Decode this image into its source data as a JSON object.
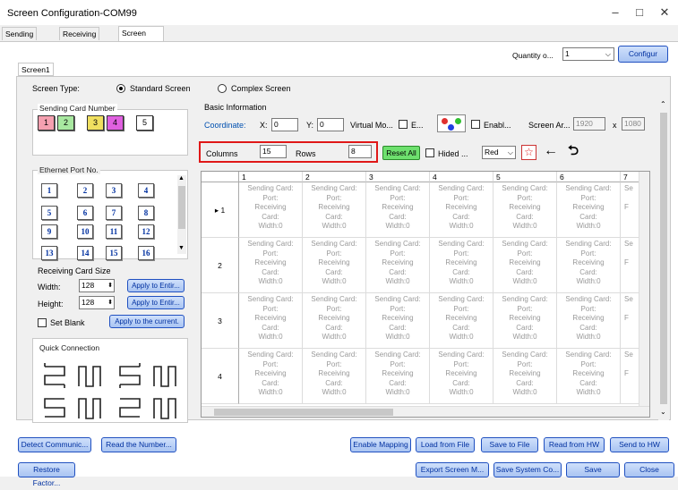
{
  "window": {
    "title": "Screen Configuration-COM99",
    "minimize": "–",
    "maximize": "□",
    "close": "✕"
  },
  "tabs": [
    "Sending Card",
    "Receiving Card",
    "Screen Connection"
  ],
  "top": {
    "quantity_label": "Quantity o...",
    "quantity_value": "1",
    "configure_label": "Configur"
  },
  "screen_tab": "Screen1",
  "screen_type": {
    "label": "Screen Type:",
    "standard": "Standard Screen",
    "complex": "Complex Screen"
  },
  "sending_card_number": {
    "label": "Sending Card Number",
    "items": [
      "1",
      "2",
      "3",
      "4",
      "5"
    ],
    "colors": [
      "#f5a0b0",
      "#a8e8a0",
      "#f0e060",
      "#e060e0",
      "#ffffff"
    ]
  },
  "ethernet": {
    "label": "Ethernet Port No.",
    "items": [
      "1",
      "2",
      "3",
      "4",
      "5",
      "6",
      "7",
      "8",
      "9",
      "10",
      "11",
      "12",
      "13",
      "14",
      "15",
      "16"
    ]
  },
  "receiving_size": {
    "label": "Receiving Card Size",
    "width_label": "Width:",
    "width_value": "128",
    "height_label": "Height:",
    "height_value": "128",
    "apply_width": "Apply to Entir...",
    "apply_height": "Apply to Entir...",
    "set_blank": "Set Blank",
    "apply_current": "Apply to the current."
  },
  "quick_connection": {
    "label": "Quick Connection"
  },
  "basic": {
    "label": "Basic Information",
    "coordinate": "Coordinate:",
    "x_label": "X:",
    "x_value": "0",
    "y_label": "Y:",
    "y_value": "0",
    "virtual": "Virtual Mo...",
    "e_label": "E...",
    "enable": "Enabl...",
    "screen_area": "Screen Ar...",
    "area_w": "1920",
    "x_sep": "x",
    "area_h": "1080",
    "columns_label": "Columns",
    "columns_value": "15",
    "rows_label": "Rows",
    "rows_value": "8",
    "reset_all": "Reset All",
    "hided": "Hided ...",
    "color_value": "Red"
  },
  "grid": {
    "columns": [
      "1",
      "2",
      "3",
      "4",
      "5",
      "6",
      "7"
    ],
    "rows": [
      "1",
      "2",
      "3",
      "4"
    ],
    "cell_lines": [
      "Sending Card:",
      "Port:",
      "Receiving",
      "Card:",
      "Width:0"
    ],
    "col7_lines": [
      "Se",
      "",
      "F",
      "",
      ""
    ]
  },
  "bottom_row1": [
    "Detect Communic...",
    "Read the Number...",
    "Enable Mapping",
    "Load from File",
    "Save to File",
    "Read from HW",
    "Send to HW"
  ],
  "bottom_row2": [
    "Restore Factor...",
    "Export Screen M...",
    "Save System Co...",
    "Save",
    "Close"
  ]
}
